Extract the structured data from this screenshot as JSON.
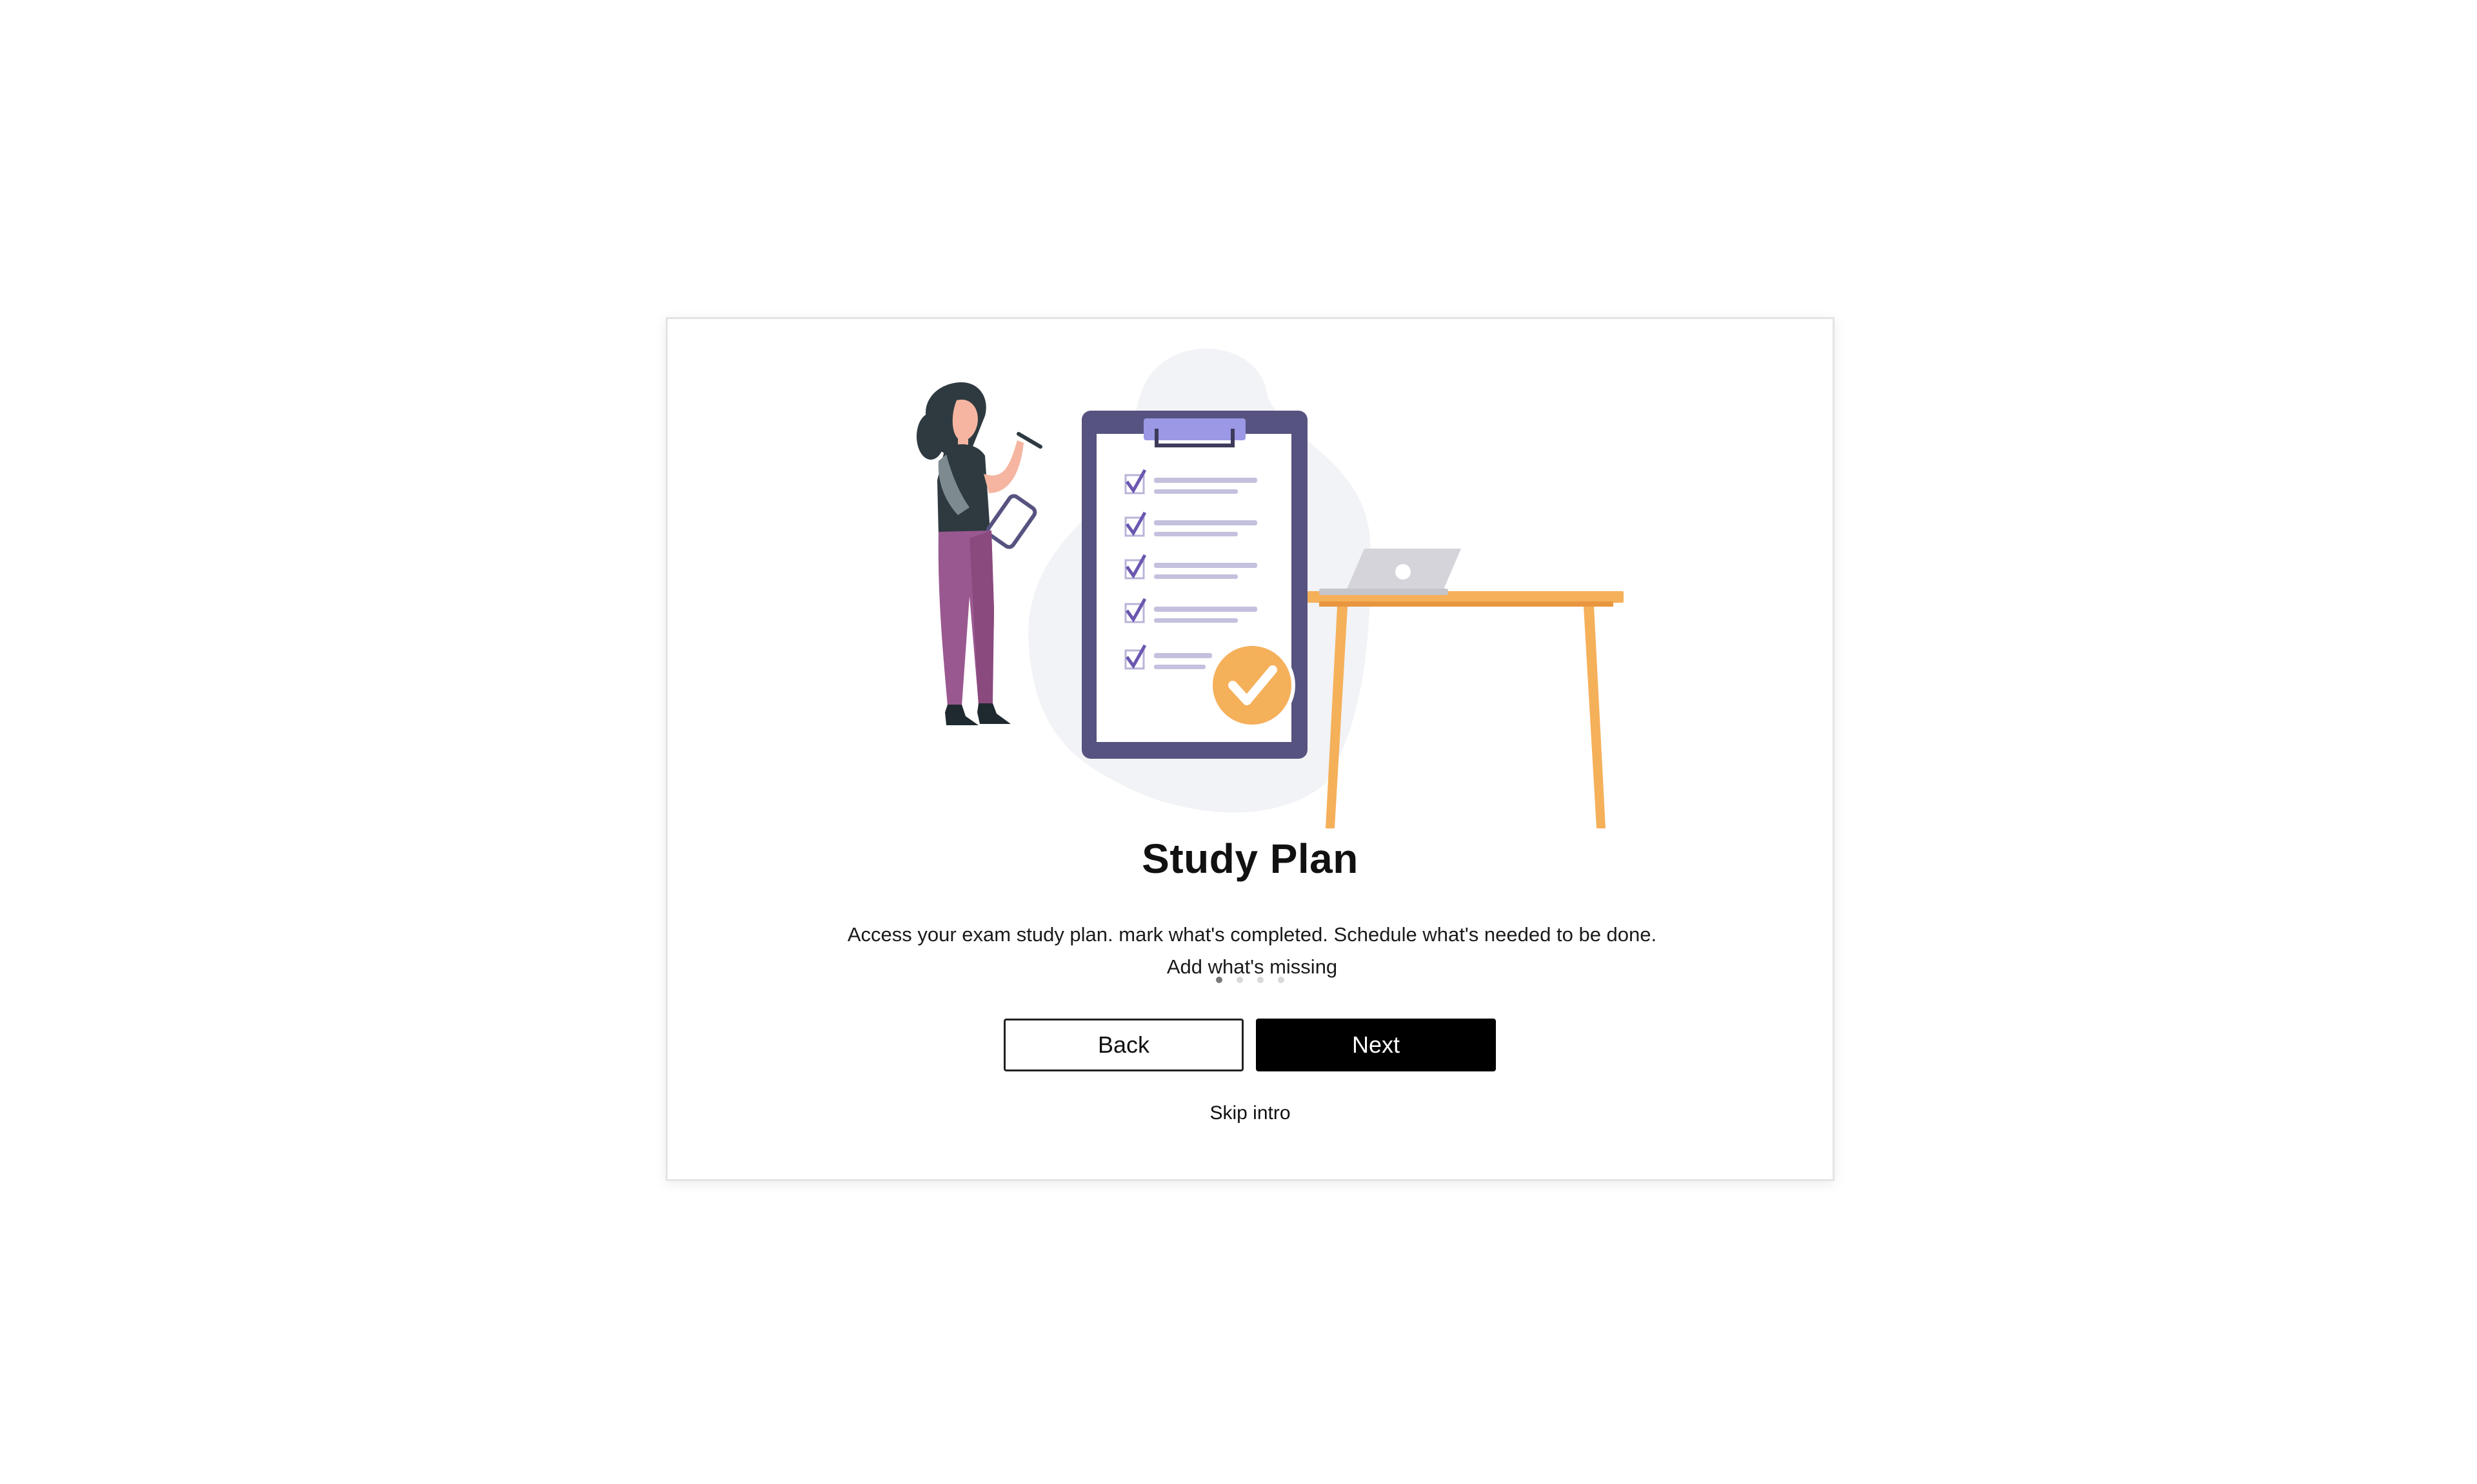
{
  "onboarding": {
    "title": "Study Plan",
    "description": "Access your exam study plan. mark what's completed. Schedule what's needed to be done. Add what's missing",
    "pagination": {
      "total": 4,
      "active_index": 0
    },
    "back_label": "Back",
    "next_label": "Next",
    "skip_label": "Skip intro"
  },
  "illustration": {
    "icons": [
      "woman-figure-icon",
      "clipboard-checklist-icon",
      "check-badge-icon",
      "laptop-icon",
      "desk-icon"
    ],
    "colors": {
      "clipboard": "#5a5780",
      "clip": "#9b98e6",
      "check": "#6b57b0",
      "badge": "#f5b05a",
      "desk": "#f5b05a",
      "pants": "#9a5890",
      "blob": "#f2f4f7"
    }
  }
}
